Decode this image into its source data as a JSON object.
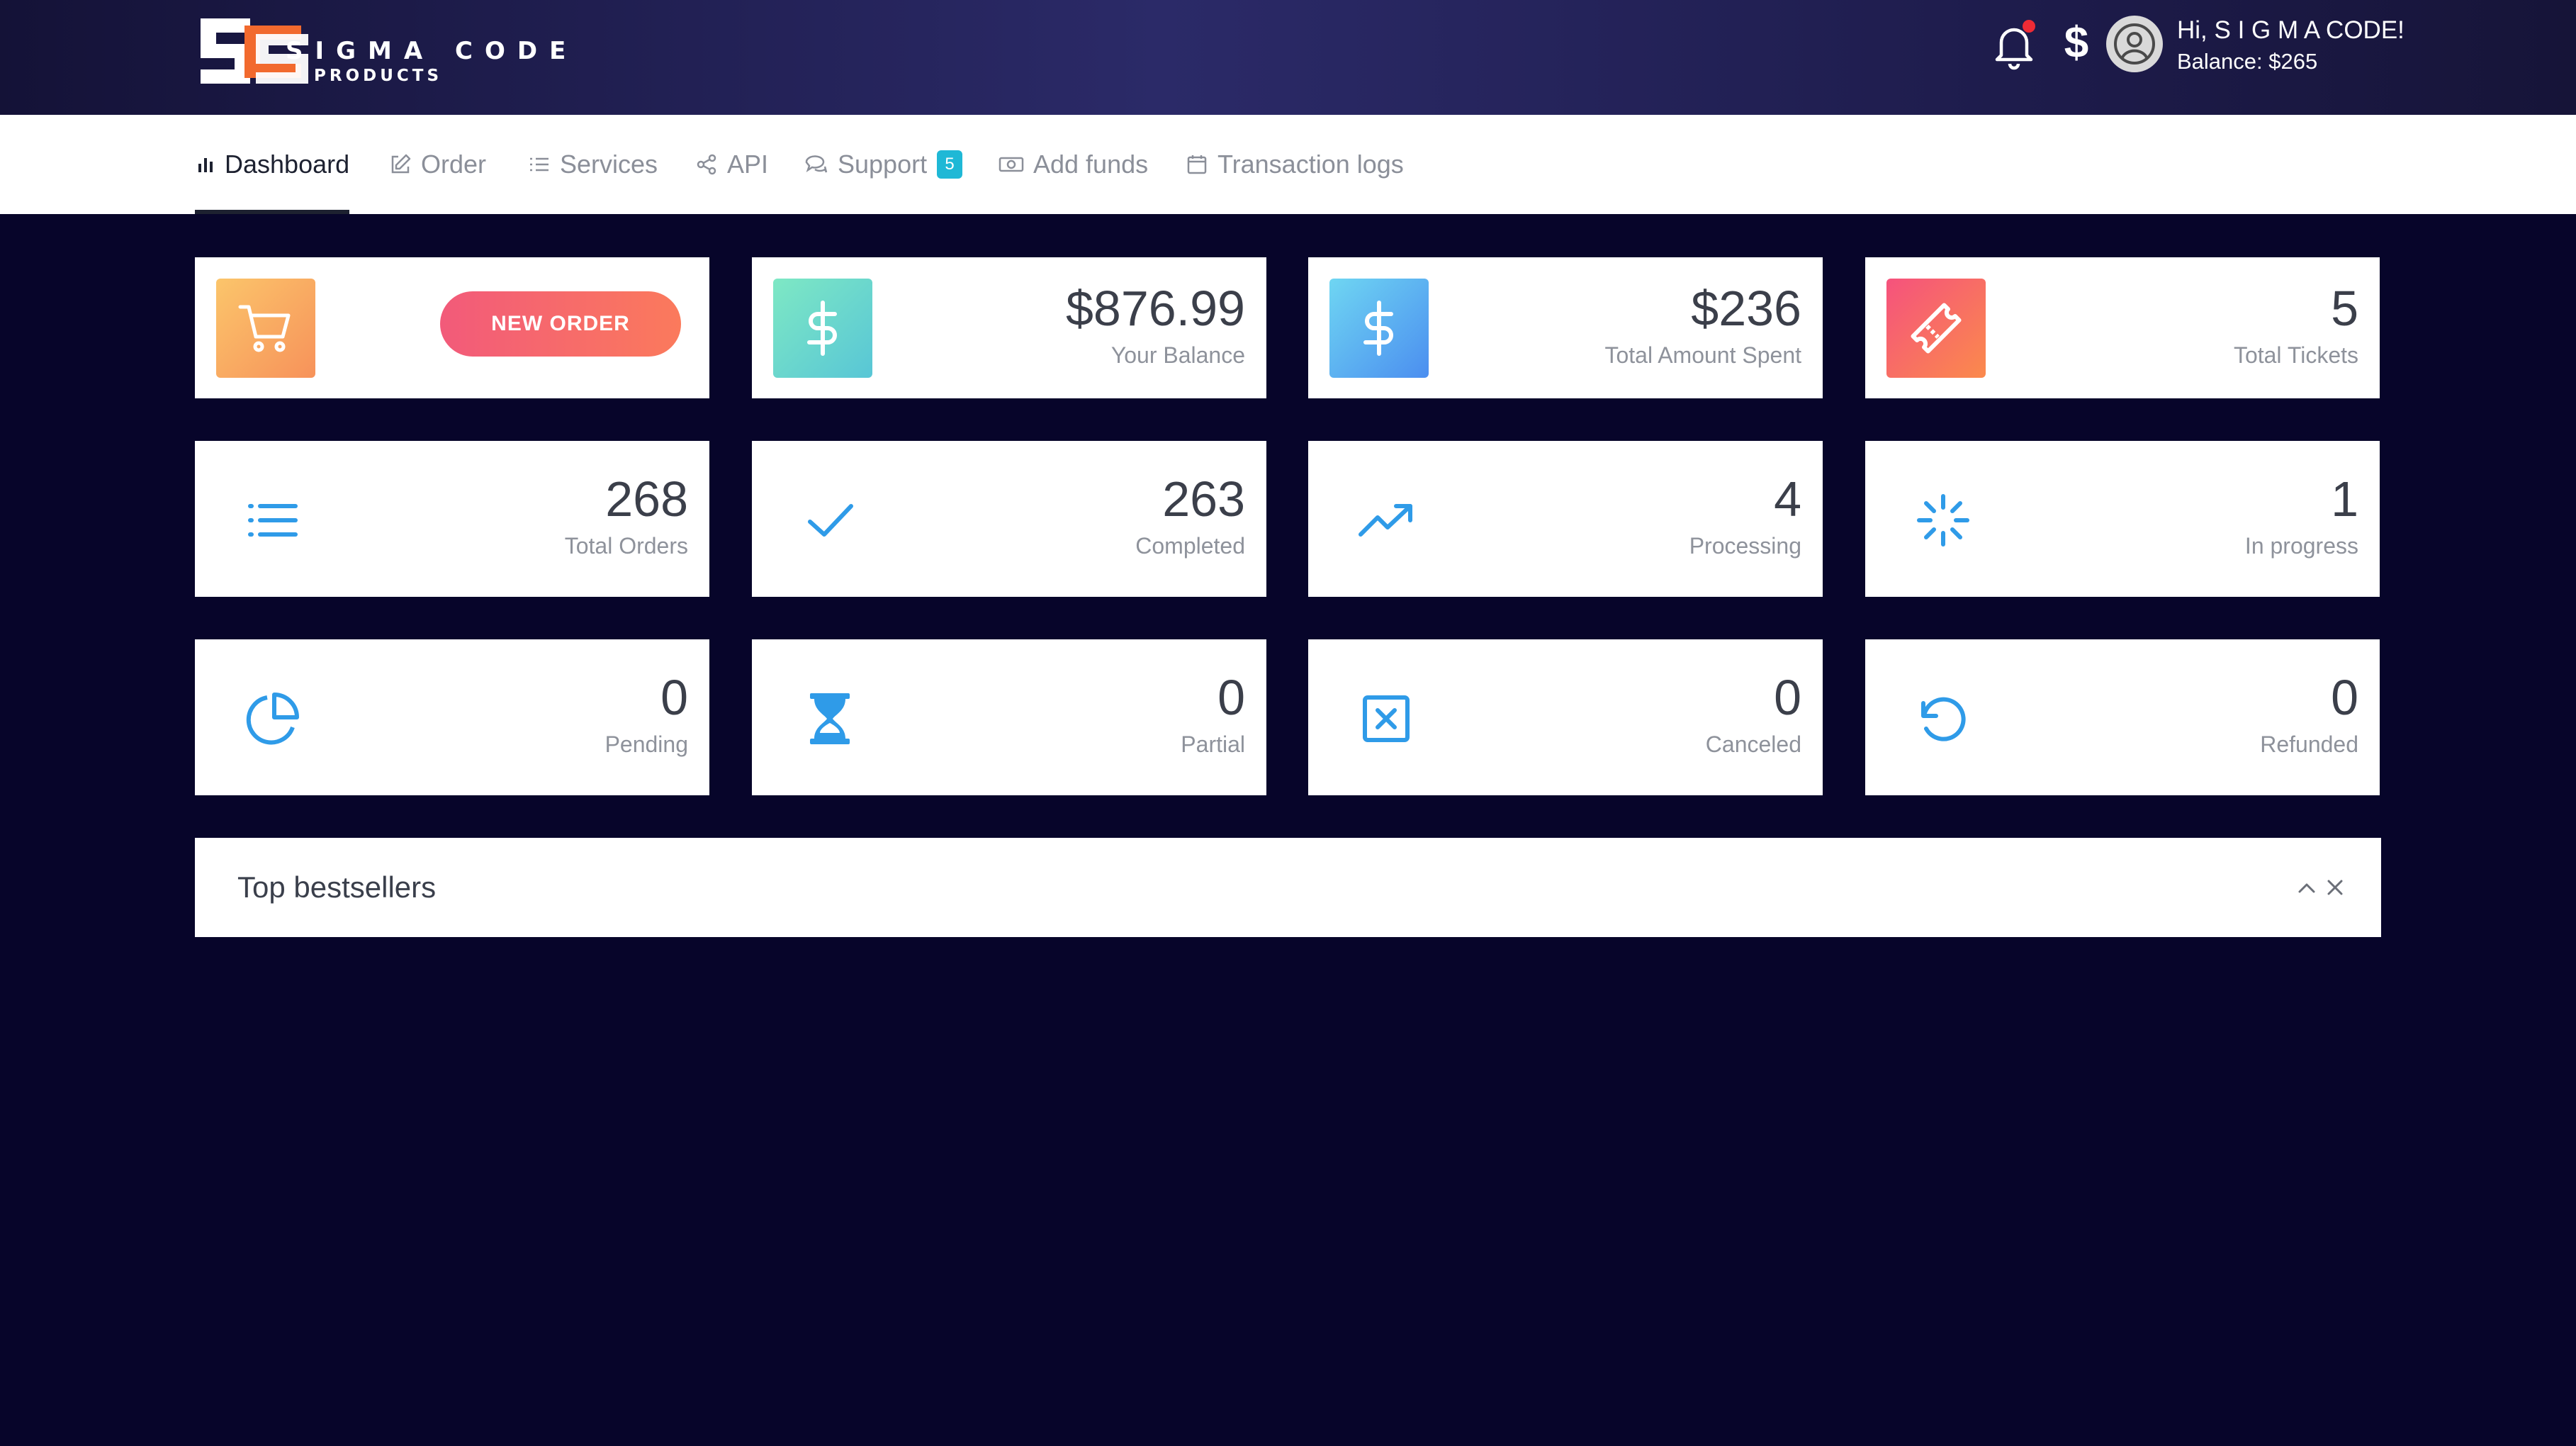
{
  "brand": {
    "name": "SIGMA CODE",
    "subtitle": "PRODUCTS",
    "colors": {
      "primary": "#ffffff",
      "accent": "#f26a2e"
    }
  },
  "header": {
    "greeting": "Hi, S I G M A CODE!",
    "balance": "Balance: $265",
    "currency_symbol": "$",
    "has_notification": true
  },
  "nav": {
    "items": [
      {
        "label": "Dashboard",
        "icon": "bar-chart-icon",
        "active": true
      },
      {
        "label": "Order",
        "icon": "edit-icon"
      },
      {
        "label": "Services",
        "icon": "list-icon"
      },
      {
        "label": "API",
        "icon": "share-icon"
      },
      {
        "label": "Support",
        "icon": "chat-icon",
        "badge": "5"
      },
      {
        "label": "Add funds",
        "icon": "cash-icon"
      },
      {
        "label": "Transaction logs",
        "icon": "calendar-icon"
      }
    ]
  },
  "cards": {
    "new_order": {
      "button": "NEW ORDER",
      "icon": "cart-icon"
    },
    "balance": {
      "value": "$876.99",
      "label": "Your Balance",
      "icon": "dollar-icon"
    },
    "spent": {
      "value": "$236",
      "label": "Total Amount Spent",
      "icon": "dollar-icon"
    },
    "tickets": {
      "value": "5",
      "label": "Total Tickets",
      "icon": "ticket-icon"
    },
    "stats": [
      {
        "value": "268",
        "label": "Total Orders",
        "icon": "list-icon"
      },
      {
        "value": "263",
        "label": "Completed",
        "icon": "check-icon"
      },
      {
        "value": "4",
        "label": "Processing",
        "icon": "trending-up-icon"
      },
      {
        "value": "1",
        "label": "In progress",
        "icon": "loader-icon"
      },
      {
        "value": "0",
        "label": "Pending",
        "icon": "pie-chart-icon"
      },
      {
        "value": "0",
        "label": "Partial",
        "icon": "hourglass-icon"
      },
      {
        "value": "0",
        "label": "Canceled",
        "icon": "x-square-icon"
      },
      {
        "value": "0",
        "label": "Refunded",
        "icon": "rotate-ccw-icon"
      }
    ]
  },
  "panel": {
    "title": "Top bestsellers",
    "controls": [
      "chevron-up-icon",
      "close-icon"
    ]
  },
  "colors": {
    "page_bg": "#07052a",
    "icon_blue": "#2f9be8",
    "badge": "#1fb8d6"
  }
}
